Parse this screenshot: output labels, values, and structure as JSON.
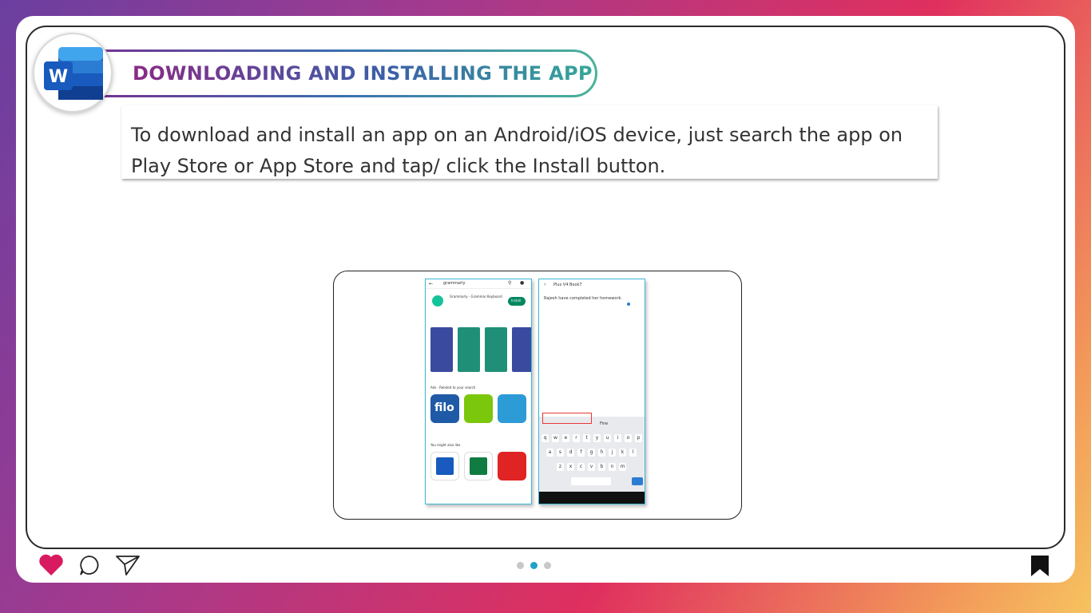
{
  "header": {
    "title": "DOWNLOADING AND INSTALLING THE APP",
    "logo_letter": "W"
  },
  "description": "To download and install an app on an Android/iOS device, just search the app on Play Store or App Store and tap/ click the Install button.",
  "screenshot": {
    "left_phone": {
      "search_text": "grammarly",
      "app_name": "Grammarly - Grammar Keyboard",
      "install_label": "Install",
      "related_heading": "Ads · Related to your search",
      "related_apps": [
        "filo",
        "",
        ""
      ],
      "also_like_heading": "You might also like",
      "also_like_apps": [
        "W",
        "X",
        "W"
      ]
    },
    "right_phone": {
      "doc_title": "Plus V4 Book7",
      "doc_text": "Rajesh have completed her homework.",
      "suggestion": "Fine",
      "keyboard_rows": [
        [
          "q",
          "w",
          "e",
          "r",
          "t",
          "y",
          "u",
          "i",
          "o",
          "p"
        ],
        [
          "a",
          "s",
          "d",
          "f",
          "g",
          "h",
          "j",
          "k",
          "l"
        ],
        [
          "z",
          "x",
          "c",
          "v",
          "b",
          "n",
          "m"
        ]
      ]
    }
  },
  "footer": {
    "like_icon": "heart-icon",
    "comment_icon": "comment-icon",
    "share_icon": "send-icon",
    "bookmark_icon": "bookmark-icon",
    "page_dots": 3,
    "active_dot": 1
  },
  "colors": {
    "accent": "#1fa3c4",
    "heart": "#d81b60",
    "title_start": "#8a2a86",
    "title_end": "#35a79a"
  }
}
